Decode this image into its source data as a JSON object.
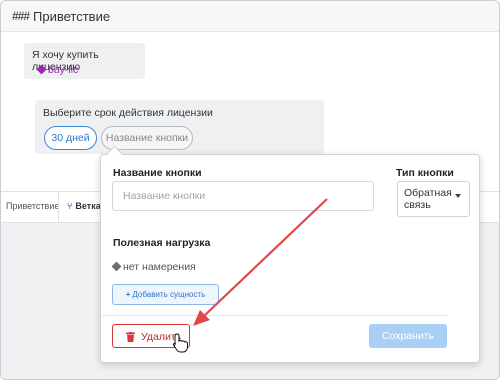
{
  "header": {
    "icon": "hash-icon",
    "title": "Приветствие"
  },
  "conversation": {
    "user_message": {
      "text": "Я хочу купить лицензию",
      "intent_tag": "buy-lic"
    },
    "bot_message": {
      "text": "Выберите срок действия лицензии",
      "buttons": [
        {
          "label": "30 дней",
          "state": "active"
        },
        {
          "label": "Название кнопки",
          "state": "editing"
        }
      ]
    }
  },
  "bottom_tabs": [
    {
      "label": "Приветствие"
    },
    {
      "label": "Ветка ,",
      "icon": "branch-icon"
    }
  ],
  "popover": {
    "name_label": "Название кнопки",
    "name_placeholder": "Название кнопки",
    "name_value": "",
    "type_label": "Тип кнопки",
    "type_value": "Обратная связь",
    "payload_label": "Полезная нагрузка",
    "no_intent_text": "нет намерения",
    "add_entity_label": "Добавить сущность",
    "delete_label": "Удалить",
    "save_label": "Сохранить"
  },
  "colors": {
    "accent_blue": "#2e77c9",
    "intent_purple": "#9b27b0",
    "danger_red": "#d9363e",
    "save_disabled": "#a9cff5",
    "annotation_arrow": "#e0474c"
  }
}
